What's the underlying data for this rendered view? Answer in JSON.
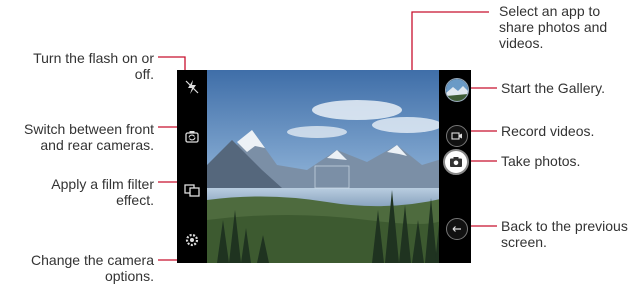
{
  "callouts": {
    "flash": "Turn the flash on or off.",
    "switch_camera": "Switch between front and rear cameras.",
    "film_filter": "Apply a film filter effect.",
    "camera_options": "Change the camera options.",
    "share": "Select an app to share photos and videos.",
    "gallery": "Start the Gallery.",
    "record": "Record videos.",
    "take_photos": "Take photos.",
    "back": "Back to the previous screen."
  },
  "colors": {
    "accent_line": "#c8102e",
    "text": "#333333",
    "sky": "#5b86b8",
    "mountain": "#6d7f93",
    "forest": "#2f4a2a"
  },
  "icons": {
    "flash": "flash-off-icon",
    "switch": "switch-camera-icon",
    "filter": "film-filter-icon",
    "settings": "gear-icon",
    "gallery": "gallery-thumbnail",
    "record": "video-camera-icon",
    "shutter": "camera-icon",
    "back": "back-arrow-icon"
  }
}
